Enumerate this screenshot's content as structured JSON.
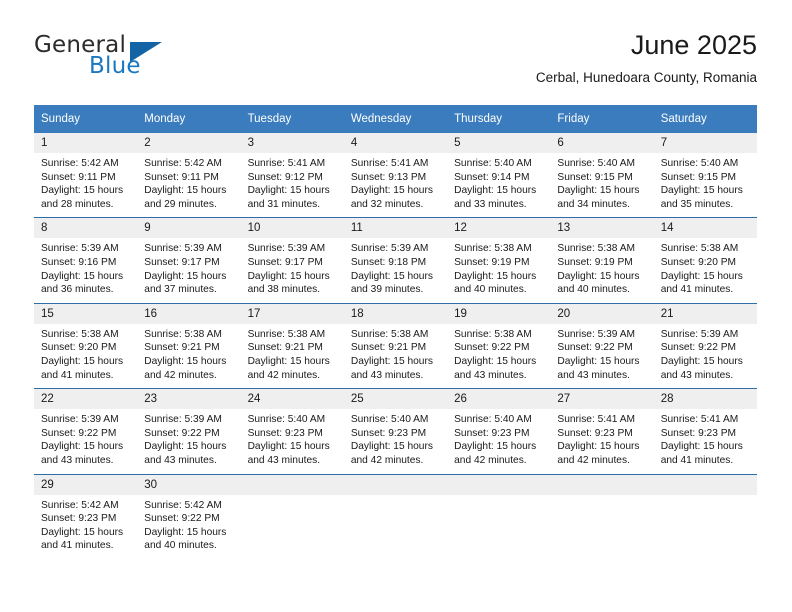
{
  "brand": {
    "name_top": "General",
    "name_bottom": "Blue",
    "triangle_color": "#1464a5",
    "blue_color": "#1a78c2"
  },
  "header": {
    "title": "June 2025",
    "subtitle": "Cerbal, Hunedoara County, Romania"
  },
  "theme": {
    "header_bg": "#3a7cbe",
    "header_text": "#ffffff",
    "row_divider": "#2f6da8",
    "daynum_bg": "#efefef"
  },
  "weekdays": [
    "Sunday",
    "Monday",
    "Tuesday",
    "Wednesday",
    "Thursday",
    "Friday",
    "Saturday"
  ],
  "weeks": [
    [
      {
        "day": "1",
        "sunrise": "Sunrise: 5:42 AM",
        "sunset": "Sunset: 9:11 PM",
        "daylight": "Daylight: 15 hours and 28 minutes."
      },
      {
        "day": "2",
        "sunrise": "Sunrise: 5:42 AM",
        "sunset": "Sunset: 9:11 PM",
        "daylight": "Daylight: 15 hours and 29 minutes."
      },
      {
        "day": "3",
        "sunrise": "Sunrise: 5:41 AM",
        "sunset": "Sunset: 9:12 PM",
        "daylight": "Daylight: 15 hours and 31 minutes."
      },
      {
        "day": "4",
        "sunrise": "Sunrise: 5:41 AM",
        "sunset": "Sunset: 9:13 PM",
        "daylight": "Daylight: 15 hours and 32 minutes."
      },
      {
        "day": "5",
        "sunrise": "Sunrise: 5:40 AM",
        "sunset": "Sunset: 9:14 PM",
        "daylight": "Daylight: 15 hours and 33 minutes."
      },
      {
        "day": "6",
        "sunrise": "Sunrise: 5:40 AM",
        "sunset": "Sunset: 9:15 PM",
        "daylight": "Daylight: 15 hours and 34 minutes."
      },
      {
        "day": "7",
        "sunrise": "Sunrise: 5:40 AM",
        "sunset": "Sunset: 9:15 PM",
        "daylight": "Daylight: 15 hours and 35 minutes."
      }
    ],
    [
      {
        "day": "8",
        "sunrise": "Sunrise: 5:39 AM",
        "sunset": "Sunset: 9:16 PM",
        "daylight": "Daylight: 15 hours and 36 minutes."
      },
      {
        "day": "9",
        "sunrise": "Sunrise: 5:39 AM",
        "sunset": "Sunset: 9:17 PM",
        "daylight": "Daylight: 15 hours and 37 minutes."
      },
      {
        "day": "10",
        "sunrise": "Sunrise: 5:39 AM",
        "sunset": "Sunset: 9:17 PM",
        "daylight": "Daylight: 15 hours and 38 minutes."
      },
      {
        "day": "11",
        "sunrise": "Sunrise: 5:39 AM",
        "sunset": "Sunset: 9:18 PM",
        "daylight": "Daylight: 15 hours and 39 minutes."
      },
      {
        "day": "12",
        "sunrise": "Sunrise: 5:38 AM",
        "sunset": "Sunset: 9:19 PM",
        "daylight": "Daylight: 15 hours and 40 minutes."
      },
      {
        "day": "13",
        "sunrise": "Sunrise: 5:38 AM",
        "sunset": "Sunset: 9:19 PM",
        "daylight": "Daylight: 15 hours and 40 minutes."
      },
      {
        "day": "14",
        "sunrise": "Sunrise: 5:38 AM",
        "sunset": "Sunset: 9:20 PM",
        "daylight": "Daylight: 15 hours and 41 minutes."
      }
    ],
    [
      {
        "day": "15",
        "sunrise": "Sunrise: 5:38 AM",
        "sunset": "Sunset: 9:20 PM",
        "daylight": "Daylight: 15 hours and 41 minutes."
      },
      {
        "day": "16",
        "sunrise": "Sunrise: 5:38 AM",
        "sunset": "Sunset: 9:21 PM",
        "daylight": "Daylight: 15 hours and 42 minutes."
      },
      {
        "day": "17",
        "sunrise": "Sunrise: 5:38 AM",
        "sunset": "Sunset: 9:21 PM",
        "daylight": "Daylight: 15 hours and 42 minutes."
      },
      {
        "day": "18",
        "sunrise": "Sunrise: 5:38 AM",
        "sunset": "Sunset: 9:21 PM",
        "daylight": "Daylight: 15 hours and 43 minutes."
      },
      {
        "day": "19",
        "sunrise": "Sunrise: 5:38 AM",
        "sunset": "Sunset: 9:22 PM",
        "daylight": "Daylight: 15 hours and 43 minutes."
      },
      {
        "day": "20",
        "sunrise": "Sunrise: 5:39 AM",
        "sunset": "Sunset: 9:22 PM",
        "daylight": "Daylight: 15 hours and 43 minutes."
      },
      {
        "day": "21",
        "sunrise": "Sunrise: 5:39 AM",
        "sunset": "Sunset: 9:22 PM",
        "daylight": "Daylight: 15 hours and 43 minutes."
      }
    ],
    [
      {
        "day": "22",
        "sunrise": "Sunrise: 5:39 AM",
        "sunset": "Sunset: 9:22 PM",
        "daylight": "Daylight: 15 hours and 43 minutes."
      },
      {
        "day": "23",
        "sunrise": "Sunrise: 5:39 AM",
        "sunset": "Sunset: 9:22 PM",
        "daylight": "Daylight: 15 hours and 43 minutes."
      },
      {
        "day": "24",
        "sunrise": "Sunrise: 5:40 AM",
        "sunset": "Sunset: 9:23 PM",
        "daylight": "Daylight: 15 hours and 43 minutes."
      },
      {
        "day": "25",
        "sunrise": "Sunrise: 5:40 AM",
        "sunset": "Sunset: 9:23 PM",
        "daylight": "Daylight: 15 hours and 42 minutes."
      },
      {
        "day": "26",
        "sunrise": "Sunrise: 5:40 AM",
        "sunset": "Sunset: 9:23 PM",
        "daylight": "Daylight: 15 hours and 42 minutes."
      },
      {
        "day": "27",
        "sunrise": "Sunrise: 5:41 AM",
        "sunset": "Sunset: 9:23 PM",
        "daylight": "Daylight: 15 hours and 42 minutes."
      },
      {
        "day": "28",
        "sunrise": "Sunrise: 5:41 AM",
        "sunset": "Sunset: 9:23 PM",
        "daylight": "Daylight: 15 hours and 41 minutes."
      }
    ],
    [
      {
        "day": "29",
        "sunrise": "Sunrise: 5:42 AM",
        "sunset": "Sunset: 9:23 PM",
        "daylight": "Daylight: 15 hours and 41 minutes."
      },
      {
        "day": "30",
        "sunrise": "Sunrise: 5:42 AM",
        "sunset": "Sunset: 9:22 PM",
        "daylight": "Daylight: 15 hours and 40 minutes."
      },
      {
        "day": "",
        "sunrise": "",
        "sunset": "",
        "daylight": ""
      },
      {
        "day": "",
        "sunrise": "",
        "sunset": "",
        "daylight": ""
      },
      {
        "day": "",
        "sunrise": "",
        "sunset": "",
        "daylight": ""
      },
      {
        "day": "",
        "sunrise": "",
        "sunset": "",
        "daylight": ""
      },
      {
        "day": "",
        "sunrise": "",
        "sunset": "",
        "daylight": ""
      }
    ]
  ]
}
